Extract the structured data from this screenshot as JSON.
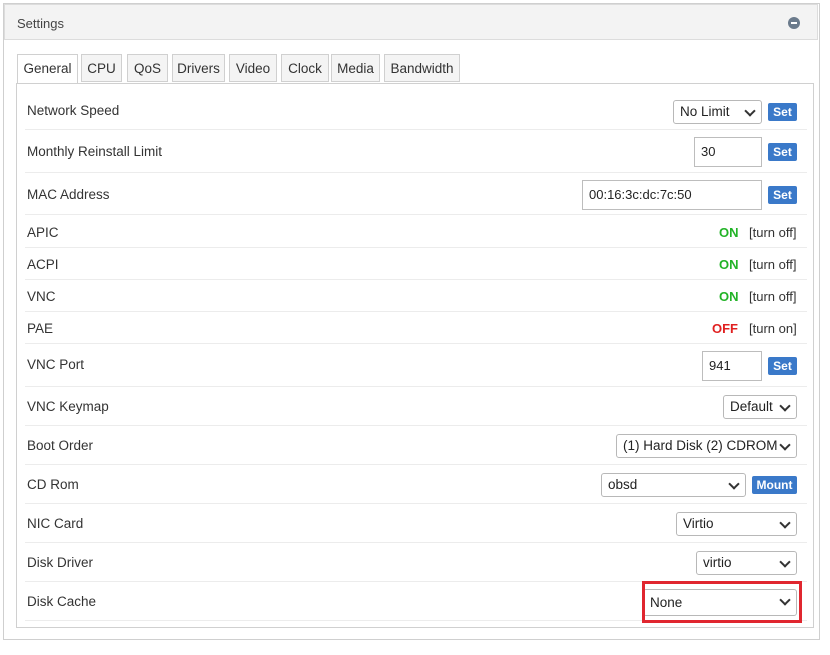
{
  "panel": {
    "title": "Settings"
  },
  "tabs": [
    "General",
    "CPU",
    "QoS",
    "Drivers",
    "Video",
    "Clock",
    "Media",
    "Bandwidth"
  ],
  "rows": {
    "network_speed": {
      "label": "Network Speed",
      "value": "No Limit",
      "button": "Set"
    },
    "reinstall_limit": {
      "label": "Monthly Reinstall Limit",
      "value": "30",
      "button": "Set"
    },
    "mac_address": {
      "label": "MAC Address",
      "value": "00:16:3c:dc:7c:50",
      "button": "Set"
    },
    "apic": {
      "label": "APIC",
      "status": "ON",
      "action": "[turn off]"
    },
    "acpi": {
      "label": "ACPI",
      "status": "ON",
      "action": "[turn off]"
    },
    "vnc": {
      "label": "VNC",
      "status": "ON",
      "action": "[turn off]"
    },
    "pae": {
      "label": "PAE",
      "status": "OFF",
      "action": "[turn on]"
    },
    "vnc_port": {
      "label": "VNC Port",
      "value": "941",
      "button": "Set"
    },
    "vnc_keymap": {
      "label": "VNC Keymap",
      "value": "Default"
    },
    "boot_order": {
      "label": "Boot Order",
      "value": "(1) Hard Disk (2) CDROM"
    },
    "cd_rom": {
      "label": "CD Rom",
      "value": "obsd",
      "button": "Mount"
    },
    "nic_card": {
      "label": "NIC Card",
      "value": "Virtio"
    },
    "disk_driver": {
      "label": "Disk Driver",
      "value": "virtio"
    },
    "disk_cache": {
      "label": "Disk Cache",
      "value": "None"
    }
  },
  "colors": {
    "on": "#22b327",
    "off": "#e02020",
    "button": "#3a79c9",
    "highlight": "#e0262f"
  }
}
